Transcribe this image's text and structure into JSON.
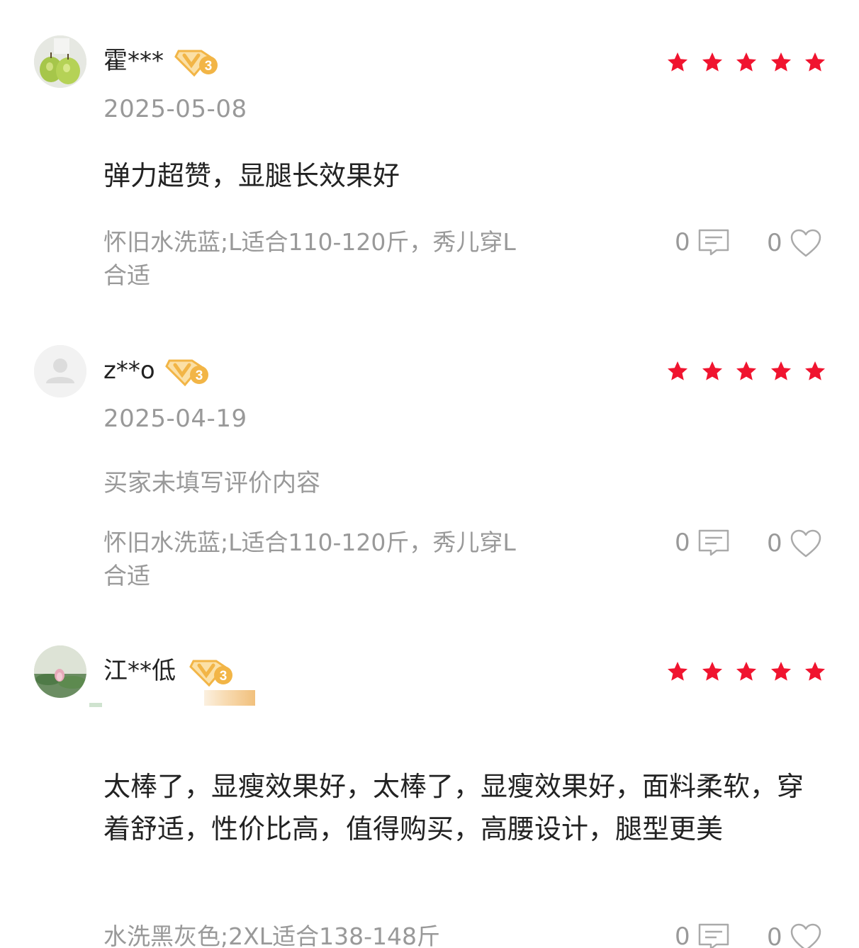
{
  "colors": {
    "star": "#f0142f",
    "muted_text": "#999999",
    "primary_text": "#222222",
    "badge_gold": "#f2b546",
    "badge_light": "#fbe0a6"
  },
  "reviews": [
    {
      "user": "霍***",
      "vip_level": "V3",
      "rating": 5,
      "date": "2025-05-08",
      "content": "弹力超赞，显腿长效果好",
      "sku_line1": "怀旧水洗蓝;L适合110-120斤，秀儿穿L",
      "sku_line2": "合适",
      "reply_count": "0",
      "like_count": "0"
    },
    {
      "user": "z**o",
      "vip_level": "V3",
      "rating": 5,
      "date": "2025-04-19",
      "content": "买家未填写评价内容",
      "sku_line1": "怀旧水洗蓝;L适合110-120斤，秀儿穿L",
      "sku_line2": "合适",
      "reply_count": "0",
      "like_count": "0"
    },
    {
      "user": "江**低",
      "vip_level": "V3",
      "rating": 5,
      "content": "太棒了，显瘦效果好，太棒了，显瘦效果好，面料柔软，穿着舒适，性价比高，值得购买，高腰设计，腿型更美",
      "sku_line1": "水洗黑灰色;2XL适合138-148斤",
      "reply_count": "0",
      "like_count": "0"
    }
  ]
}
